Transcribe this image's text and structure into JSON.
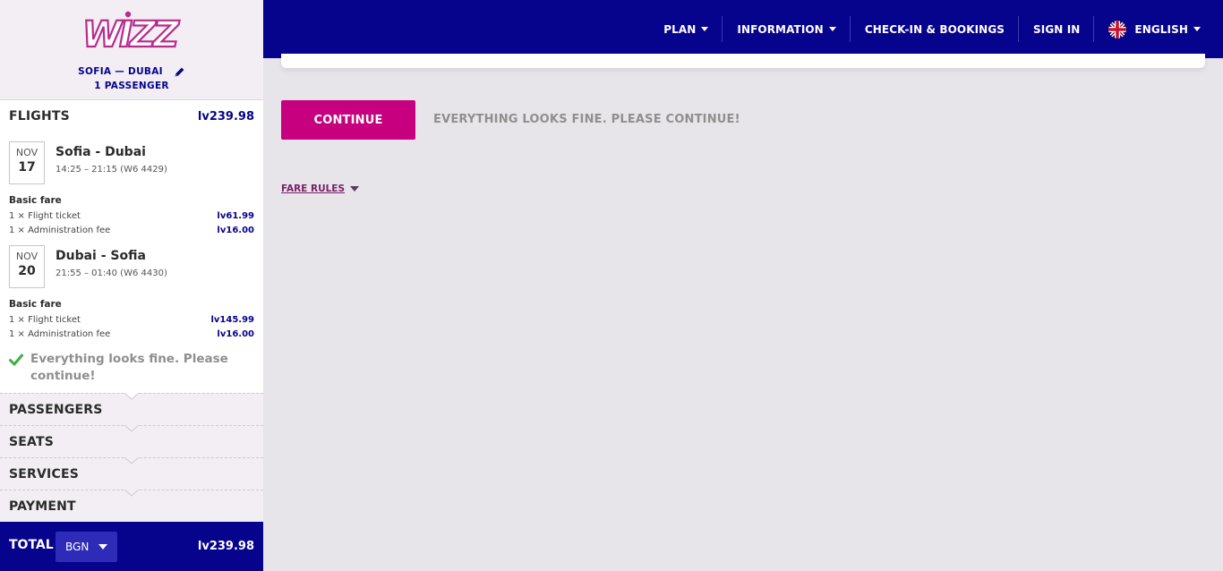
{
  "brand": {
    "logo_text": "WIZZ",
    "route": "SOFIA — DUBAI",
    "passengers": "1 PASSENGER"
  },
  "flights": {
    "title": "FLIGHTS",
    "total": "lv239.98",
    "items": [
      {
        "month": "NOV",
        "day": "17",
        "route": "Sofia - Dubai",
        "time": "14:25 – 21:15 (W6 4429)",
        "fare_name": "Basic fare",
        "lines": [
          {
            "label": "1 × Flight ticket",
            "amount": "lv61.99"
          },
          {
            "label": "1 × Administration fee",
            "amount": "lv16.00"
          }
        ]
      },
      {
        "month": "NOV",
        "day": "20",
        "route": "Dubai - Sofia",
        "time": "21:55 – 01:40 (W6 4430)",
        "fare_name": "Basic fare",
        "lines": [
          {
            "label": "1 × Flight ticket",
            "amount": "lv145.99"
          },
          {
            "label": "1 × Administration fee",
            "amount": "lv16.00"
          }
        ]
      }
    ],
    "status_message": "Everything looks fine. Please continue!"
  },
  "steps": [
    "PASSENGERS",
    "SEATS",
    "SERVICES",
    "PAYMENT"
  ],
  "total": {
    "label": "TOTAL",
    "currency": "BGN",
    "amount": "lv239.98"
  },
  "nav": {
    "plan": "PLAN",
    "information": "INFORMATION",
    "checkin": "CHECK-IN & BOOKINGS",
    "signin": "SIGN IN",
    "language": "ENGLISH"
  },
  "main": {
    "continue_label": "CONTINUE",
    "hint": "EVERYTHING LOOKS FINE. PLEASE CONTINUE!",
    "fare_rules": "FARE RULES"
  },
  "colors": {
    "brand_navy": "#06038d",
    "accent_magenta": "#c6007e",
    "success_green": "#3cb043"
  }
}
